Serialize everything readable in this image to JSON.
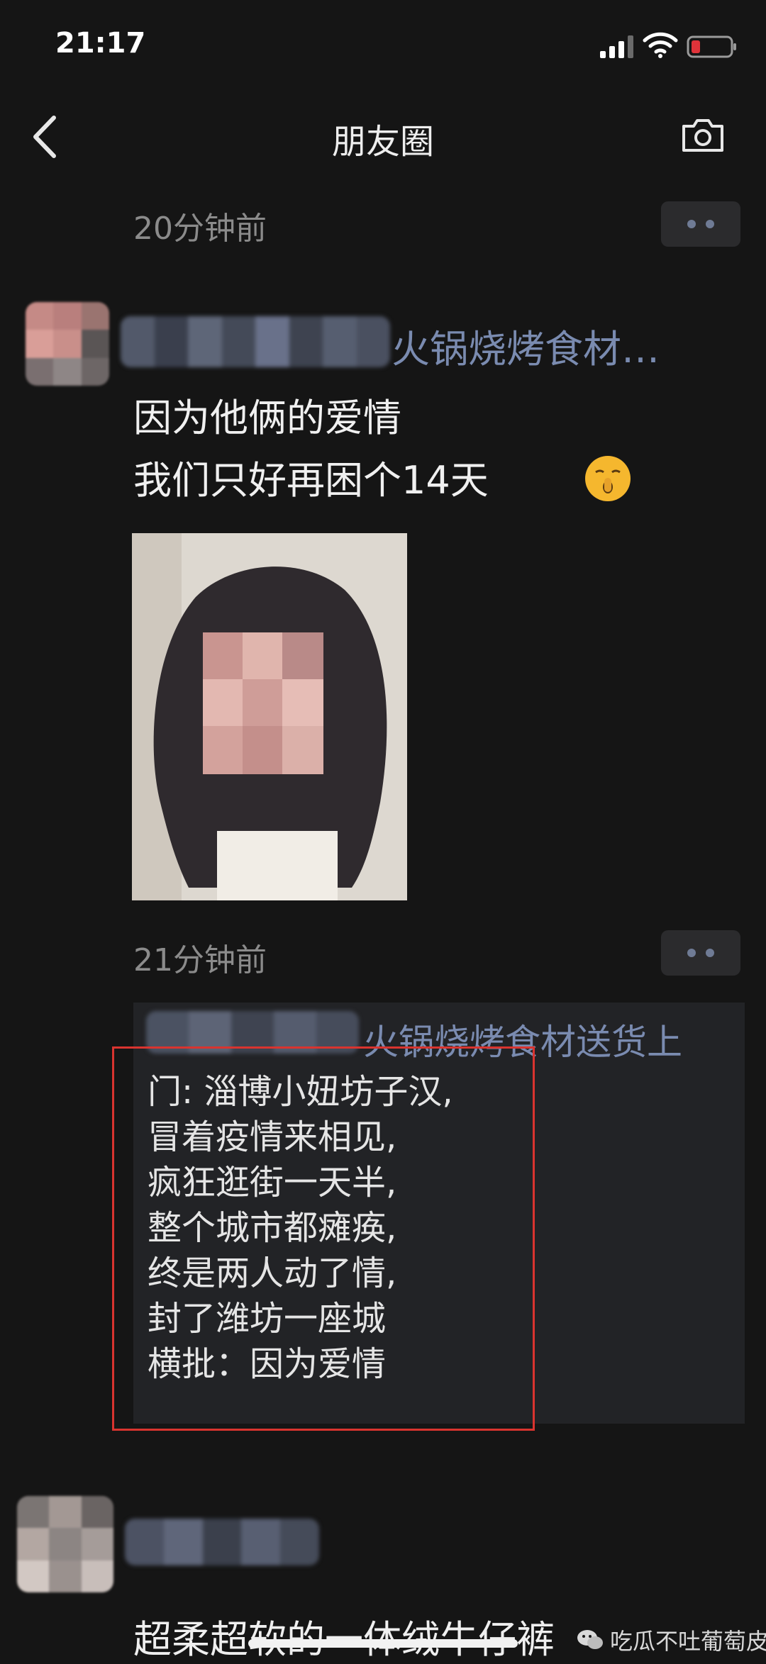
{
  "status": {
    "time": "21:17"
  },
  "nav": {
    "title": "朋友圈"
  },
  "posts": [
    {
      "time": "20分钟前"
    },
    {
      "nickname_suffix": "火锅烧烤食材…",
      "lines": [
        "因为他俩的爱情",
        "我们只好再困个14天"
      ],
      "time": "21分钟前",
      "forward": {
        "nickname_suffix": "火锅烧烤食材送货上",
        "text": "门: 淄博小妞坊子汉,\n冒着疫情来相见,\n疯狂逛街一天半,\n整个城市都瘫痪,\n终是两人动了情,\n封了潍坊一座城\n横批：因为爱情"
      }
    },
    {
      "line": "超柔超软的一体绒牛仔裤"
    }
  ],
  "watermark": "吃瓜不吐葡萄皮",
  "icons": [
    "signal-icon",
    "wifi-icon",
    "battery-icon",
    "back-arrow-icon",
    "camera-icon",
    "more-dots-icon",
    "shush-emoji-icon",
    "wechat-logo-icon"
  ]
}
